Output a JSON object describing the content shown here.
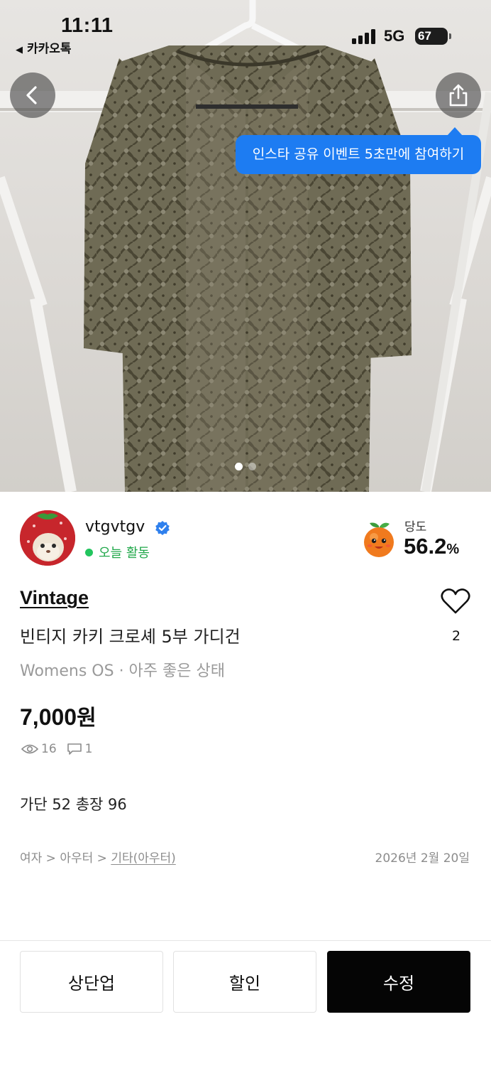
{
  "status_bar": {
    "time": "11:11",
    "back_app": "카카오톡",
    "network": "5G",
    "battery": "67"
  },
  "photo": {
    "share_tooltip": "인스타 공유 이벤트 5초만에 참여하기",
    "page_count": 2,
    "current_page": 1
  },
  "seller": {
    "name": "vtgvtgv",
    "activity": "오늘 활동",
    "sweetness_label": "당도",
    "sweetness_value": "56.2",
    "sweetness_unit": "%"
  },
  "product": {
    "brand": "Vintage",
    "title": "빈티지 카키 크로셰 5부 가디건",
    "subtitle": "Womens OS · 아주 좋은 상태",
    "price": "7,000",
    "price_unit": "원",
    "views": "16",
    "comments": "1",
    "likes": "2",
    "description": "가단 52 총장 96",
    "category_path": "여자 > 아우터 > ",
    "category_last": "기타(아우터)",
    "date": "2026년 2월 20일"
  },
  "actions": {
    "bump": "상단업",
    "discount": "할인",
    "edit": "수정"
  },
  "colors": {
    "accent_blue": "#1d7cf2",
    "active_green": "#22c55e",
    "primary_button": "#050505"
  }
}
